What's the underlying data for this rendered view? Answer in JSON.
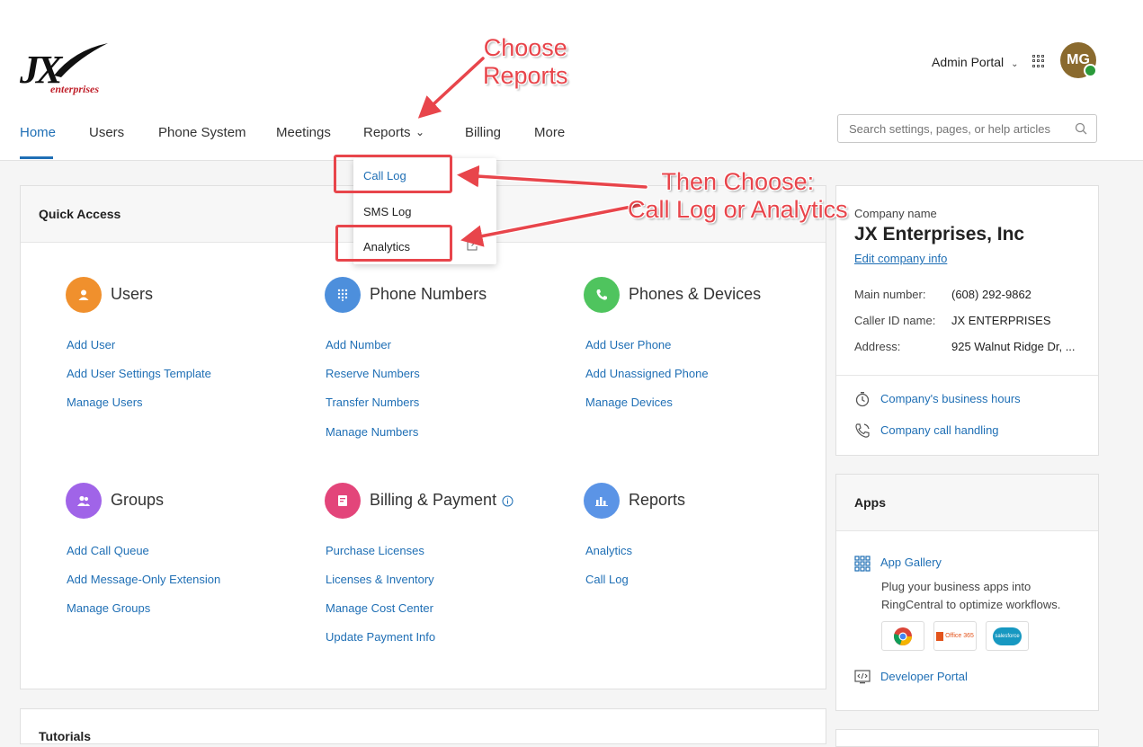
{
  "logo": {
    "mark": "JX",
    "sub": "enterprises"
  },
  "header": {
    "admin_portal": "Admin Portal",
    "avatar_initials": "MG",
    "search_placeholder": "Search settings, pages, or help articles"
  },
  "nav": [
    "Home",
    "Users",
    "Phone System",
    "Meetings",
    "Reports",
    "Billing",
    "More"
  ],
  "dropdown": [
    "Call Log",
    "SMS Log",
    "Analytics"
  ],
  "quick_access": {
    "title": "Quick Access",
    "sections": [
      {
        "title": "Users",
        "color": "#f0902d",
        "links": [
          "Add User",
          "Add User Settings Template",
          "Manage Users"
        ]
      },
      {
        "title": "Phone Numbers",
        "color": "#4d8fdc",
        "links": [
          "Add Number",
          "Reserve Numbers",
          "Transfer Numbers",
          "Manage Numbers"
        ]
      },
      {
        "title": "Phones & Devices",
        "color": "#4fc45e",
        "links": [
          "Add User Phone",
          "Add Unassigned Phone",
          "Manage Devices"
        ]
      },
      {
        "title": "Groups",
        "color": "#a064e8",
        "links": [
          "Add Call Queue",
          "Add Message-Only Extension",
          "Manage Groups"
        ]
      },
      {
        "title": "Billing & Payment",
        "color": "#e3457a",
        "links": [
          "Purchase Licenses",
          "Licenses & Inventory",
          "Manage Cost Center",
          "Update Payment Info"
        ]
      },
      {
        "title": "Reports",
        "color": "#5b94e6",
        "links": [
          "Analytics",
          "Call Log"
        ]
      }
    ]
  },
  "tutorials": {
    "title": "Tutorials"
  },
  "company": {
    "label": "Company name",
    "name": "JX Enterprises, Inc",
    "edit_link": "Edit company info",
    "main_number_label": "Main number:",
    "main_number": "(608) 292-9862",
    "caller_id_label": "Caller ID name:",
    "caller_id": "JX ENTERPRISES",
    "address_label": "Address:",
    "address": "925 Walnut Ridge Dr, ...",
    "hours_link": "Company's business hours",
    "handling_link": "Company call handling"
  },
  "apps": {
    "title": "Apps",
    "gallery_link": "App Gallery",
    "description_line1": "Plug your business apps into",
    "description_line2": "RingCentral to optimize workflows.",
    "tile_office": "Office 365",
    "tile_salesforce": "salesforce",
    "developer_link": "Developer Portal"
  },
  "annotations": {
    "choose_line1": "Choose",
    "choose_line2": "Reports",
    "then_line1": "Then Choose:",
    "then_line2": "Call Log or Analytics",
    "color": "#e8454b"
  }
}
